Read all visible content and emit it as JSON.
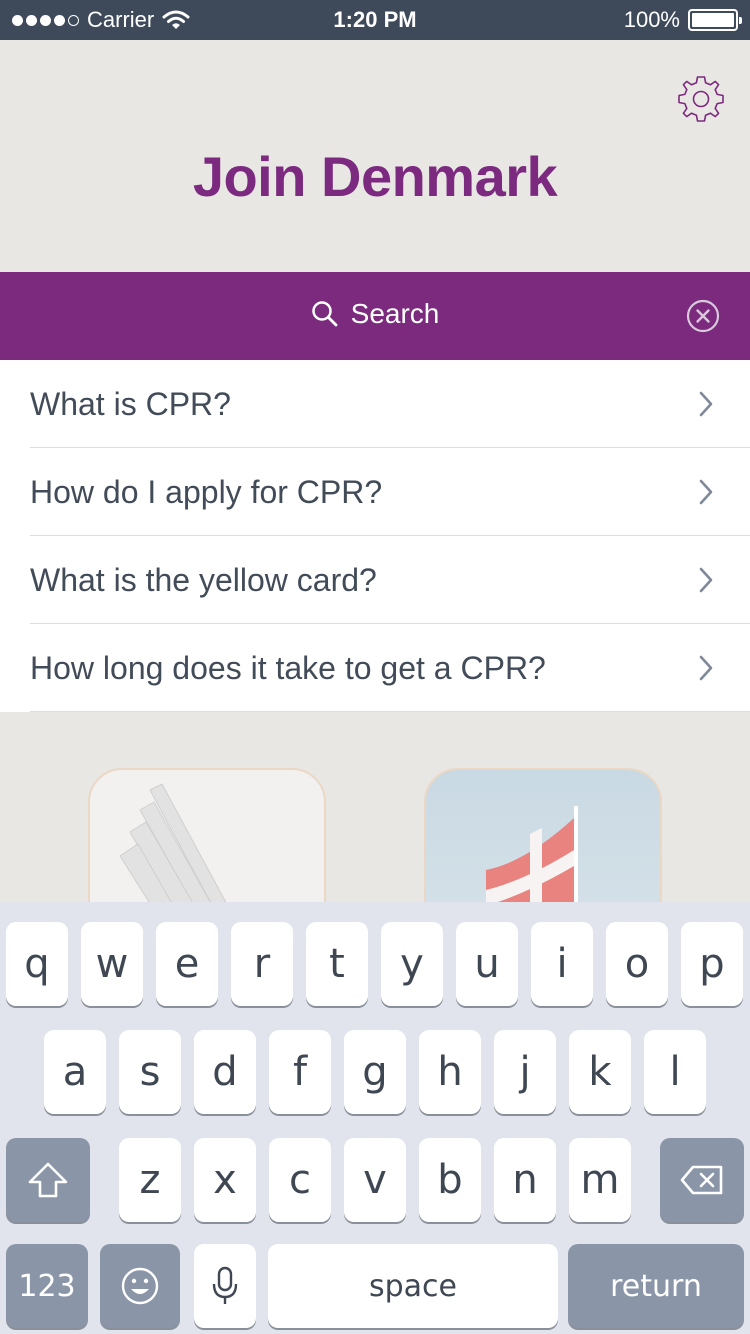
{
  "status_bar": {
    "carrier": "Carrier",
    "time": "1:20 PM",
    "battery": "100%"
  },
  "header": {
    "title": "Join Denmark",
    "settings_icon": "gear-icon"
  },
  "search": {
    "placeholder": "Search",
    "clear_icon": "clear-circle-icon"
  },
  "results": [
    {
      "label": "What is CPR?"
    },
    {
      "label": "How do I apply for CPR?"
    },
    {
      "label": "What is the yellow card?"
    },
    {
      "label": "How long does it take to get a CPR?"
    }
  ],
  "keyboard": {
    "row1": [
      "q",
      "w",
      "e",
      "r",
      "t",
      "y",
      "u",
      "i",
      "o",
      "p"
    ],
    "row2": [
      "a",
      "s",
      "d",
      "f",
      "g",
      "h",
      "j",
      "k",
      "l"
    ],
    "row3": [
      "z",
      "x",
      "c",
      "v",
      "b",
      "n",
      "m"
    ],
    "numbers_label": "123",
    "space_label": "space",
    "return_label": "return"
  },
  "colors": {
    "brand": "#7b2a7e",
    "status_bar": "#3e4a5a",
    "background": "#e9e7e4",
    "text": "#424b58"
  }
}
